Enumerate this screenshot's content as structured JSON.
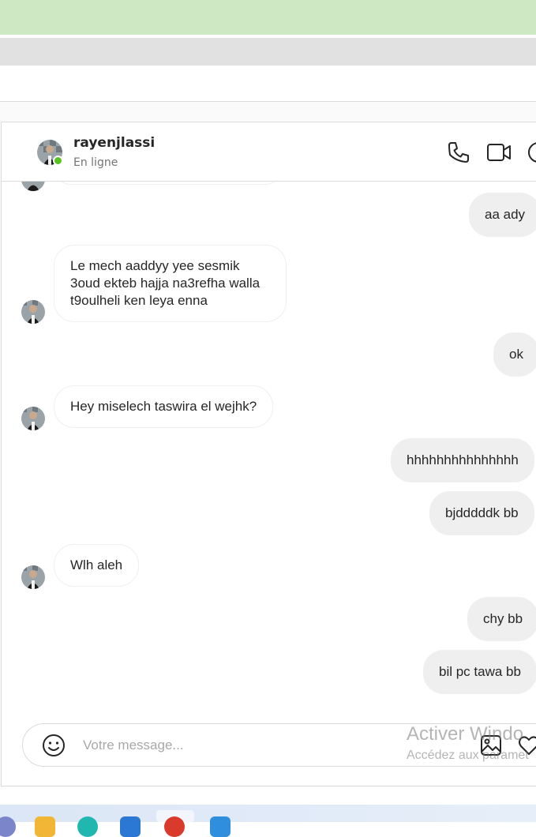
{
  "chat": {
    "username": "rayenjlassi",
    "status": "En ligne",
    "header_icons": [
      "phone-icon",
      "video-icon",
      "info-icon"
    ]
  },
  "messages": [
    {
      "from": "me",
      "text": "aa ady"
    },
    {
      "from": "them",
      "text": "Le mech aaddyy yee sesmik\n3oud ekteb hajja na3refha walla\nt9oulheli ken leya enna"
    },
    {
      "from": "me",
      "text": "ok"
    },
    {
      "from": "them",
      "text": "Hey miselech taswira el wejhk?"
    },
    {
      "from": "me",
      "text": "hhhhhhhhhhhhhhh"
    },
    {
      "from": "me",
      "text": "bjdddddk bb"
    },
    {
      "from": "them",
      "text": "Wlh aleh"
    },
    {
      "from": "me",
      "text": "chy bb"
    },
    {
      "from": "me",
      "text": "bil pc tawa bb"
    }
  ],
  "composer": {
    "placeholder": "Votre message...",
    "icons": [
      "emoji-icon",
      "image-icon",
      "heart-icon"
    ]
  },
  "watermark": {
    "line1": "Activer Windo",
    "line2": "Accédez aux paramet"
  },
  "colors": {
    "top_bar": "#cde8c3",
    "online": "#58c322",
    "outgoing_bubble": "#efefef"
  }
}
